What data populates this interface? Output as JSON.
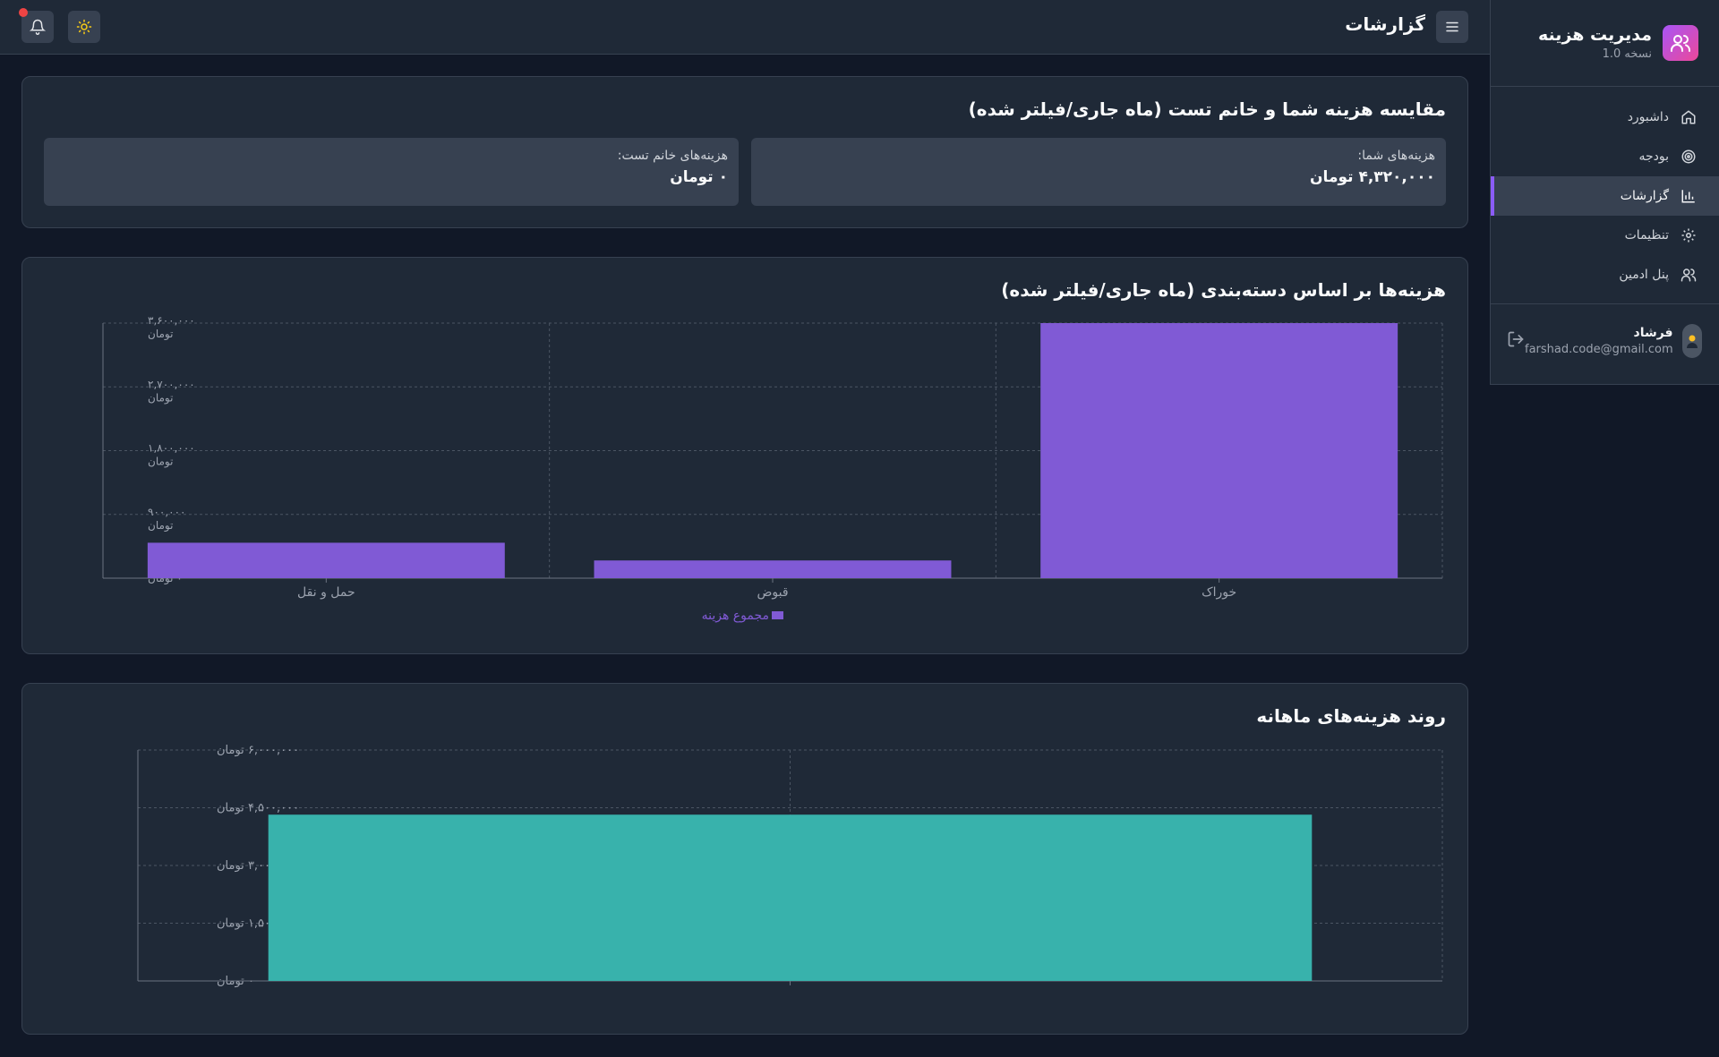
{
  "sidebar": {
    "title": "مدیریت هزینه",
    "version": "نسخه 1.0",
    "nav": [
      {
        "label": "داشبورد",
        "icon": "home-icon",
        "active": false
      },
      {
        "label": "بودجه",
        "icon": "target-icon",
        "active": false
      },
      {
        "label": "گزارشات",
        "icon": "bar-chart-icon",
        "active": true
      },
      {
        "label": "تنظیمات",
        "icon": "gear-icon",
        "active": false
      },
      {
        "label": "پنل ادمین",
        "icon": "users-icon",
        "active": false
      }
    ],
    "user": {
      "name": "فرشاد",
      "email": "farshad.code@gmail.com"
    }
  },
  "header": {
    "title": "گزارشات",
    "menu_icon": "menu-icon",
    "bell_icon": "bell-icon",
    "theme_icon": "sun-icon"
  },
  "comparison": {
    "title": "مقایسه هزینه شما و خانم تست (ماه جاری/فیلتر شده)",
    "yours_label": "هزینه‌های شما:",
    "yours_value": "۴,۳۲۰,۰۰۰ تومان",
    "other_label": "هزینه‌های خانم تست:",
    "other_value": "۰ تومان"
  },
  "category_chart": {
    "title": "هزینه‌ها بر اساس دسته‌بندی (ماه جاری/فیلتر شده)"
  },
  "monthly_chart": {
    "title": "روند هزینه‌های ماهانه"
  },
  "colors": {
    "accent": "#8b5cf6",
    "bar_purple": "#805ad5",
    "bar_teal": "#38b2ac",
    "background": "#111827",
    "card": "#1f2937"
  },
  "chart_data": [
    {
      "type": "bar",
      "categories": [
        "حمل و نقل",
        "قبوض",
        "خوراک"
      ],
      "series": [
        {
          "name": "مجموع هزینه",
          "values": [
            500000,
            250000,
            3600000
          ]
        }
      ],
      "ylim": [
        0,
        3600000
      ],
      "yticks": [
        0,
        900000,
        1800000,
        2700000,
        3600000
      ],
      "ytick_labels": [
        "۰ تومان",
        "۹۰۰,۰۰۰ تومان",
        "۱,۸۰۰,۰۰۰ تومان",
        "۲,۷۰۰,۰۰۰ تومان",
        "۳,۶۰۰,۰۰۰ تومان"
      ],
      "grid": true,
      "legend": "bottom"
    },
    {
      "type": "bar",
      "categories": [
        ""
      ],
      "series": [
        {
          "name": "",
          "values": [
            4320000
          ]
        }
      ],
      "ylim": [
        0,
        6000000
      ],
      "yticks": [
        0,
        1500000,
        3000000,
        4500000,
        6000000
      ],
      "ytick_labels": [
        "۰ تومان",
        "۱,۵۰۰,۰۰۰ تومان",
        "۳,۰۰۰,۰۰۰ تومان",
        "۴,۵۰۰,۰۰۰ تومان",
        "۶,۰۰۰,۰۰۰ تومان"
      ],
      "grid": true
    }
  ]
}
